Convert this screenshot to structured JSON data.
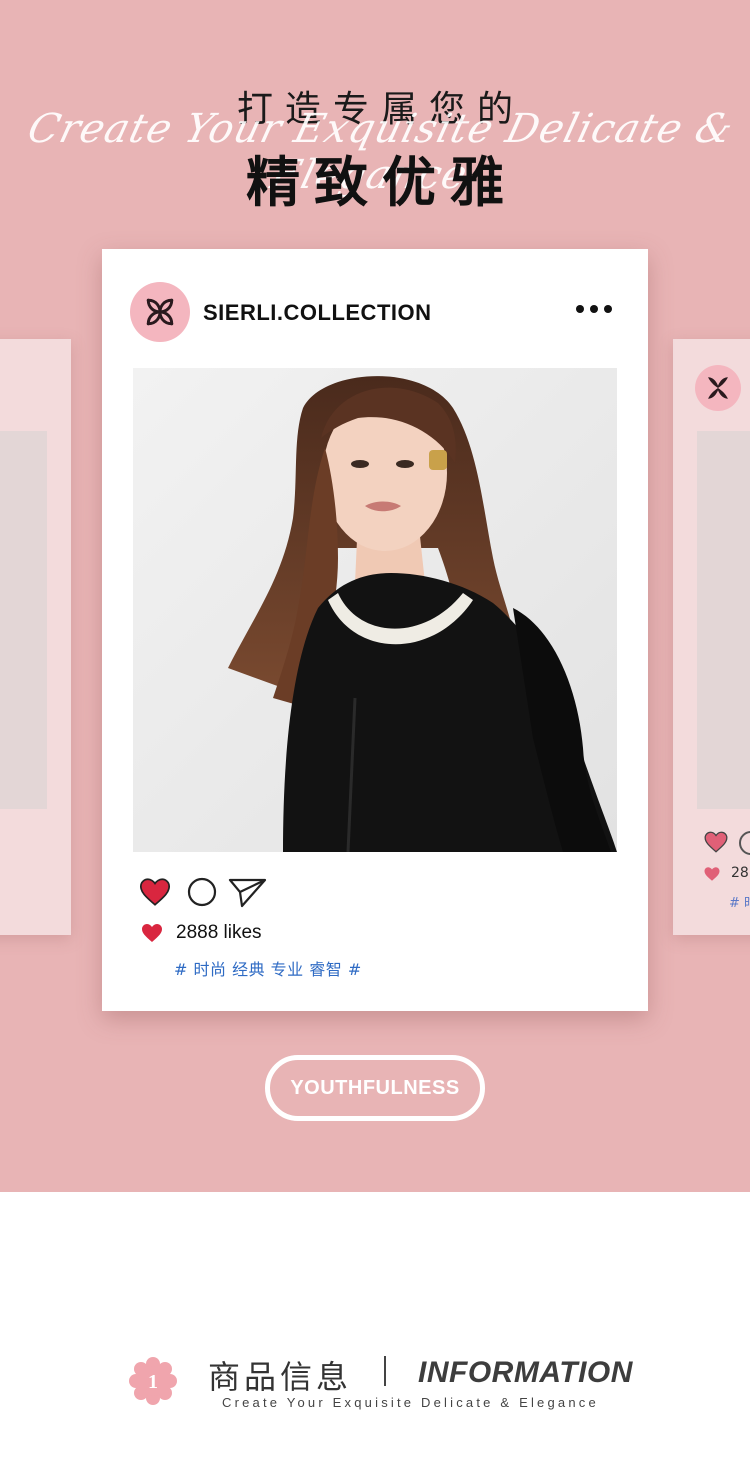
{
  "hero": {
    "script_line": "Create Your Exquisite Delicate & Elegance",
    "title_line_1": "打造专属您的",
    "title_line_2": "精致优雅"
  },
  "post": {
    "handle": "SIERLI.COLLECTION",
    "more_icon": "more-dots-icon",
    "photo_desc_icon": "model-photo",
    "actions": [
      "heart-icon",
      "comment-icon",
      "share-icon"
    ],
    "likes": "2888 likes",
    "tags": "# 时尚 经典 专业 睿智 #"
  },
  "ghost_right": {
    "likes": "28",
    "tag": "# 时"
  },
  "cta": {
    "label": "YOUTHFULNESS"
  },
  "info": {
    "badge": "1",
    "title_cn": "商品信息",
    "title_en": "INFORMATION",
    "subtitle": "Create Your Exquisite Delicate & Elegance"
  },
  "colors": {
    "background_pink": "#e8b4b5",
    "accent_pink": "#f4b6bf",
    "heart_red": "#d9263f",
    "tag_blue": "#2f6bc4"
  }
}
